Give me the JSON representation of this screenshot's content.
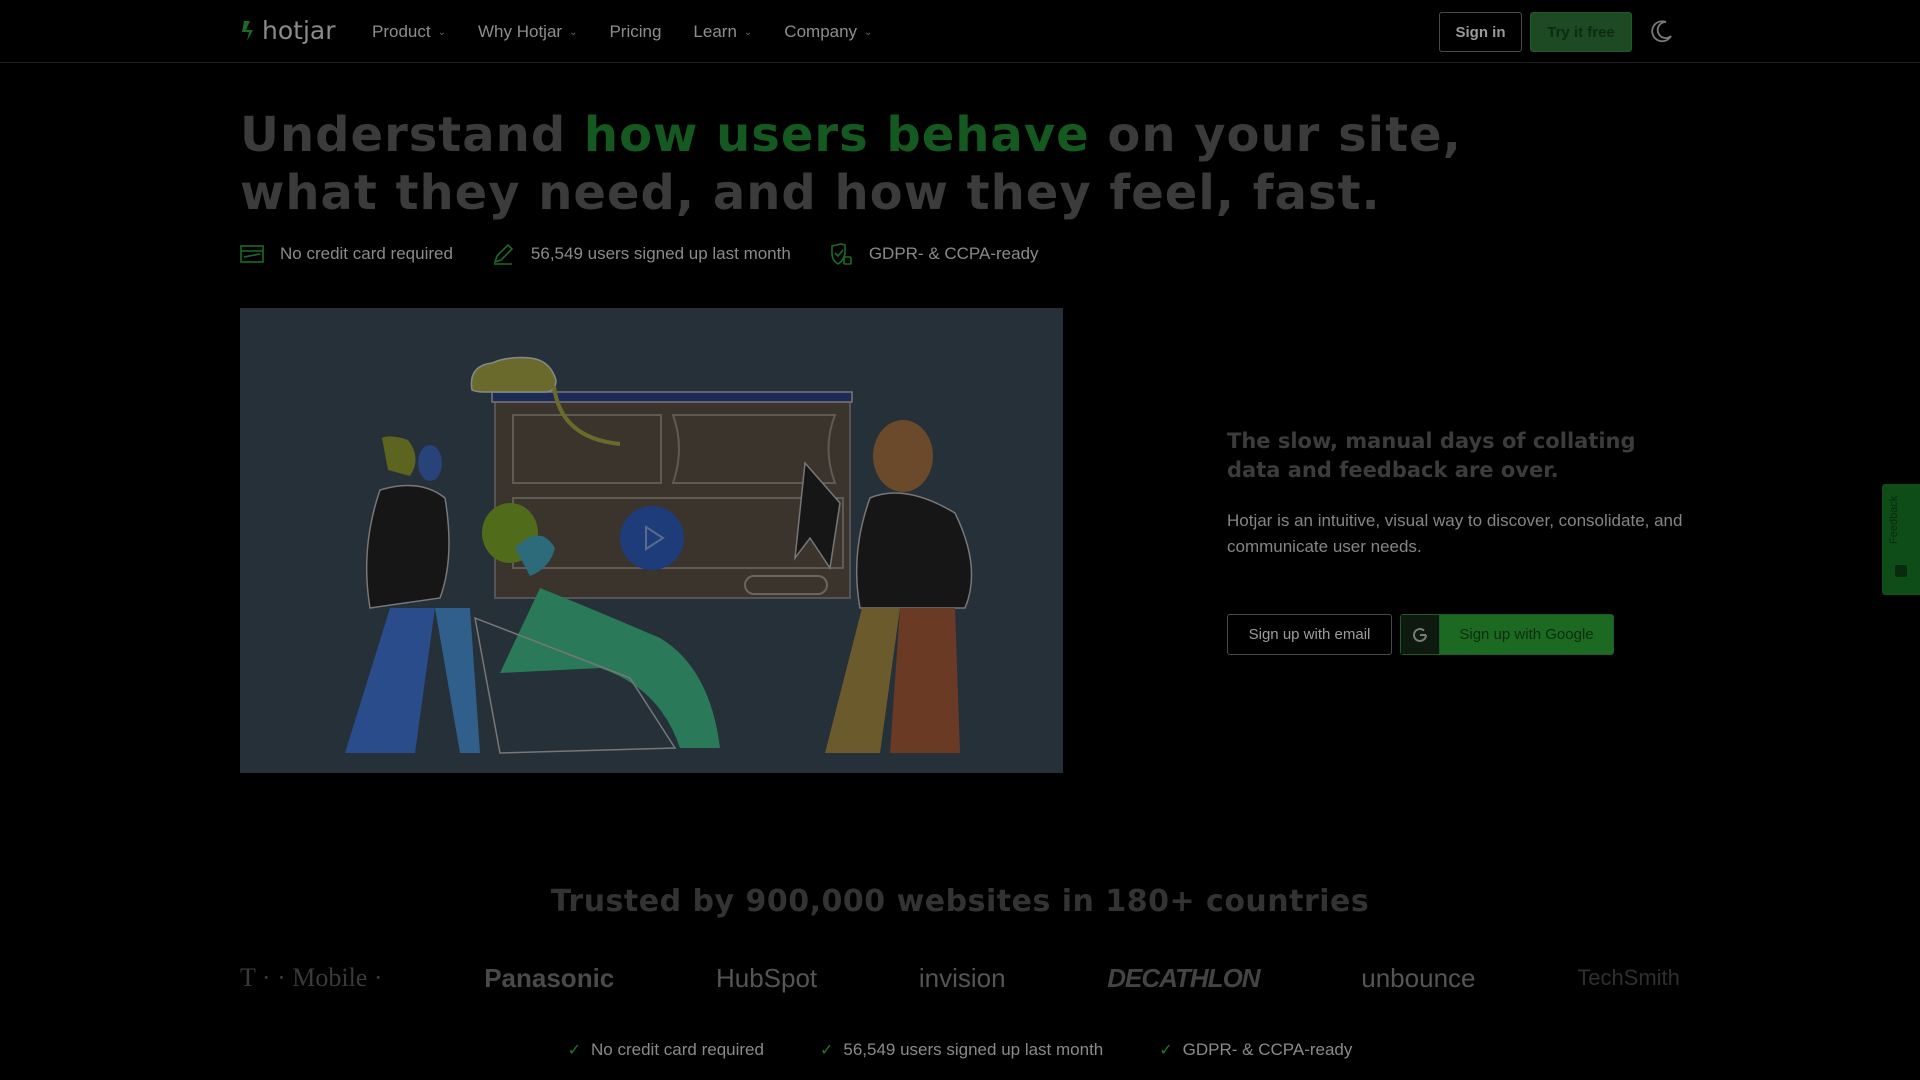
{
  "header": {
    "logo_text": "hotjar",
    "nav": [
      {
        "label": "Product",
        "has_menu": true
      },
      {
        "label": "Why Hotjar",
        "has_menu": true
      },
      {
        "label": "Pricing",
        "has_menu": false
      },
      {
        "label": "Learn",
        "has_menu": true
      },
      {
        "label": "Company",
        "has_menu": true
      }
    ],
    "signin_label": "Sign in",
    "try_label": "Try it free",
    "theme_icon": "moon-icon"
  },
  "hero": {
    "headline_pre": "Understand ",
    "headline_highlight": "how users behave",
    "headline_post": " on your site, what they need, and how they feel, fast.",
    "badges": [
      {
        "icon": "credit-card-icon",
        "text": "No credit card required"
      },
      {
        "icon": "pencil-icon",
        "text": "56,549 users signed up last month"
      },
      {
        "icon": "shield-check-icon",
        "text": "GDPR- & CCPA-ready"
      }
    ],
    "subheading": "The slow, manual days of collating data and feedback are over.",
    "description": "Hotjar is an intuitive, visual way to discover, consolidate, and communicate user needs.",
    "signup_email_label": "Sign up with email",
    "signup_google_label": "Sign up with Google"
  },
  "feedback_tab": {
    "label": "Feedback"
  },
  "trusted": {
    "heading": "Trusted by 900,000 websites in 180+ countries",
    "logos": [
      "T · · Mobile ·",
      "Panasonic",
      "HubSpot",
      "invision",
      "DECATHLON",
      "unbounce",
      "TechSmith"
    ]
  },
  "bottom_badges": [
    "No credit card required",
    "56,549 users signed up last month",
    "GDPR- & CCPA-ready"
  ],
  "colors": {
    "background": "#000000",
    "accent_green": "#14591f",
    "button_green": "#1c6a21",
    "illustration_bg": "#263038"
  }
}
